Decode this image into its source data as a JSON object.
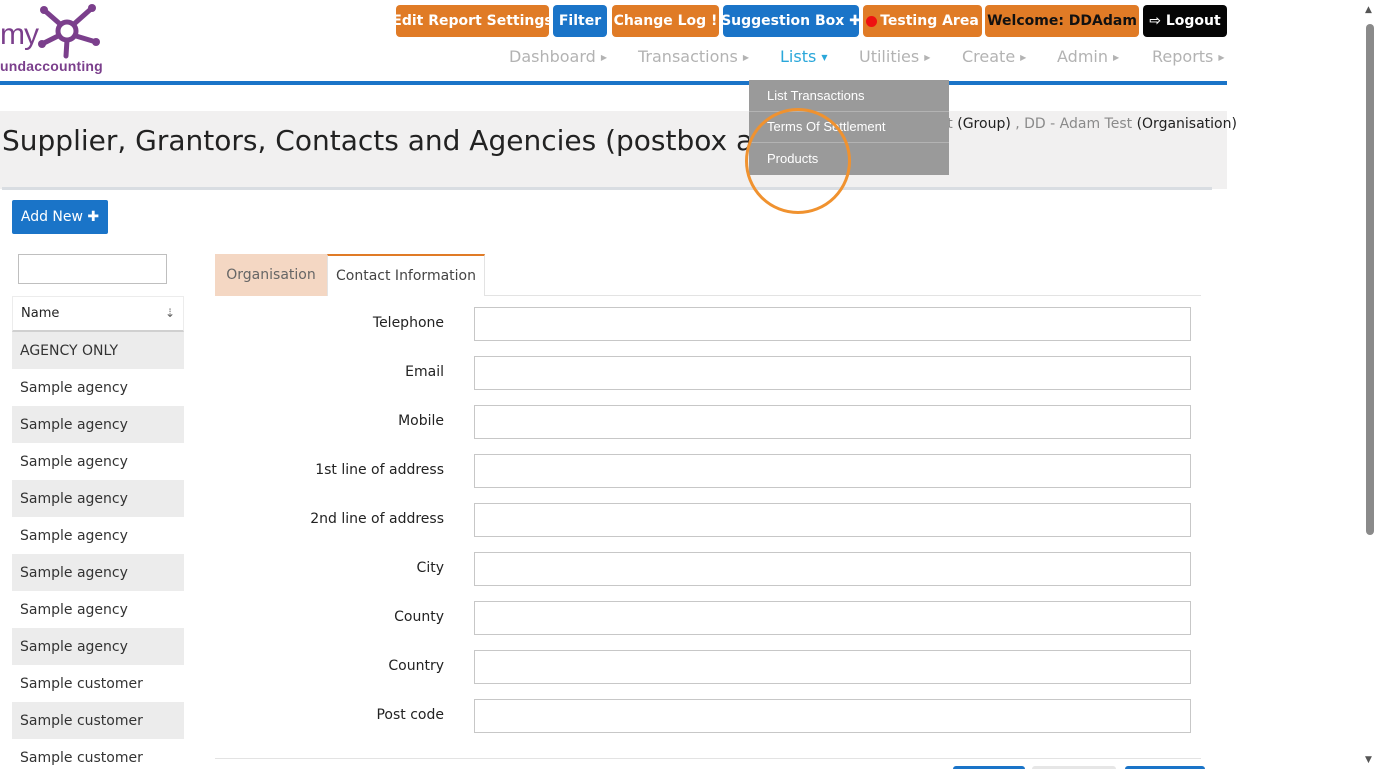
{
  "logo": {
    "text_top": "my",
    "text_bottom": "undaccounting"
  },
  "topbar": {
    "edit_report": "Edit Report Settings",
    "filter": "Filter",
    "change_log": "Change Log",
    "change_log_icon": "!",
    "suggestion_box": "Suggestion Box",
    "suggestion_icon": "✚",
    "testing_area": "Testing Area",
    "welcome": "Welcome:  DDAdam",
    "logout": "Logout",
    "logout_icon": "⇨"
  },
  "nav": {
    "dashboard": "Dashboard",
    "transactions": "Transactions",
    "lists": "Lists",
    "utilities": "Utilities",
    "create": "Create",
    "admin": "Admin",
    "reports": "Reports"
  },
  "lists_menu": {
    "items": [
      "List Transactions",
      "Terms Of Settlement",
      "Products"
    ]
  },
  "page": {
    "title": "Supplier, Grantors, Contacts and Agencies (postbox a/cs)",
    "breadcrumb": {
      "part1": "st",
      "part1_label": " (Group)",
      "sep": " , ",
      "part2": "DD - Adam Test",
      "part2_label": " (Organisation)"
    }
  },
  "add_new": {
    "label": "Add New",
    "icon": "✚"
  },
  "search": {
    "value": ""
  },
  "list": {
    "header": "Name",
    "sort_icon": "⇣",
    "rows": [
      "AGENCY ONLY",
      "Sample agency",
      "Sample agency",
      "Sample agency",
      "Sample agency",
      "Sample agency",
      "Sample agency",
      "Sample agency",
      "Sample agency",
      "Sample customer",
      "Sample customer",
      "Sample customer"
    ]
  },
  "tabs": {
    "organisation": "Organisation",
    "contact": "Contact Information"
  },
  "form": {
    "fields": [
      {
        "label": "Telephone",
        "value": ""
      },
      {
        "label": "Email",
        "value": ""
      },
      {
        "label": "Mobile",
        "value": ""
      },
      {
        "label": "1st line of address",
        "value": ""
      },
      {
        "label": "2nd line of address",
        "value": ""
      },
      {
        "label": "City",
        "value": ""
      },
      {
        "label": "County",
        "value": ""
      },
      {
        "label": "Country",
        "value": ""
      },
      {
        "label": "Post code",
        "value": ""
      }
    ]
  },
  "colors": {
    "orange": "#e07b26",
    "blue": "#1a74c8",
    "accent_link": "#2aa7da",
    "highlight": "#f0922f"
  }
}
